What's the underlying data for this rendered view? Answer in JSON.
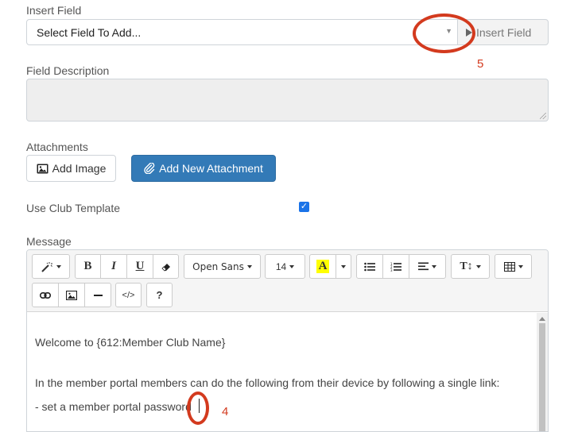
{
  "insert_field": {
    "label": "Insert Field",
    "select_value": "Select Field To Add...",
    "button_label": "Insert Field"
  },
  "field_description": {
    "label": "Field Description",
    "value": ""
  },
  "attachments": {
    "label": "Attachments",
    "add_image_label": "Add Image",
    "add_attachment_label": "Add New Attachment"
  },
  "use_club_template": {
    "label": "Use Club Template",
    "checked": true
  },
  "message": {
    "label": "Message",
    "toolbar": {
      "font_name": "Open Sans",
      "font_size": "14",
      "bold": "B",
      "italic": "I",
      "underline": "U",
      "help": "?"
    },
    "lines": [
      "Welcome to {612:Member Club Name}",
      "In the member portal members can do the following from their device by following a single link:",
      "- set a member portal password"
    ]
  },
  "annotations": {
    "annotation_5": "5",
    "annotation_4": "4"
  },
  "colors": {
    "primary": "#337ab7",
    "annotation": "#d33a1e",
    "highlight": "#ffff00"
  }
}
